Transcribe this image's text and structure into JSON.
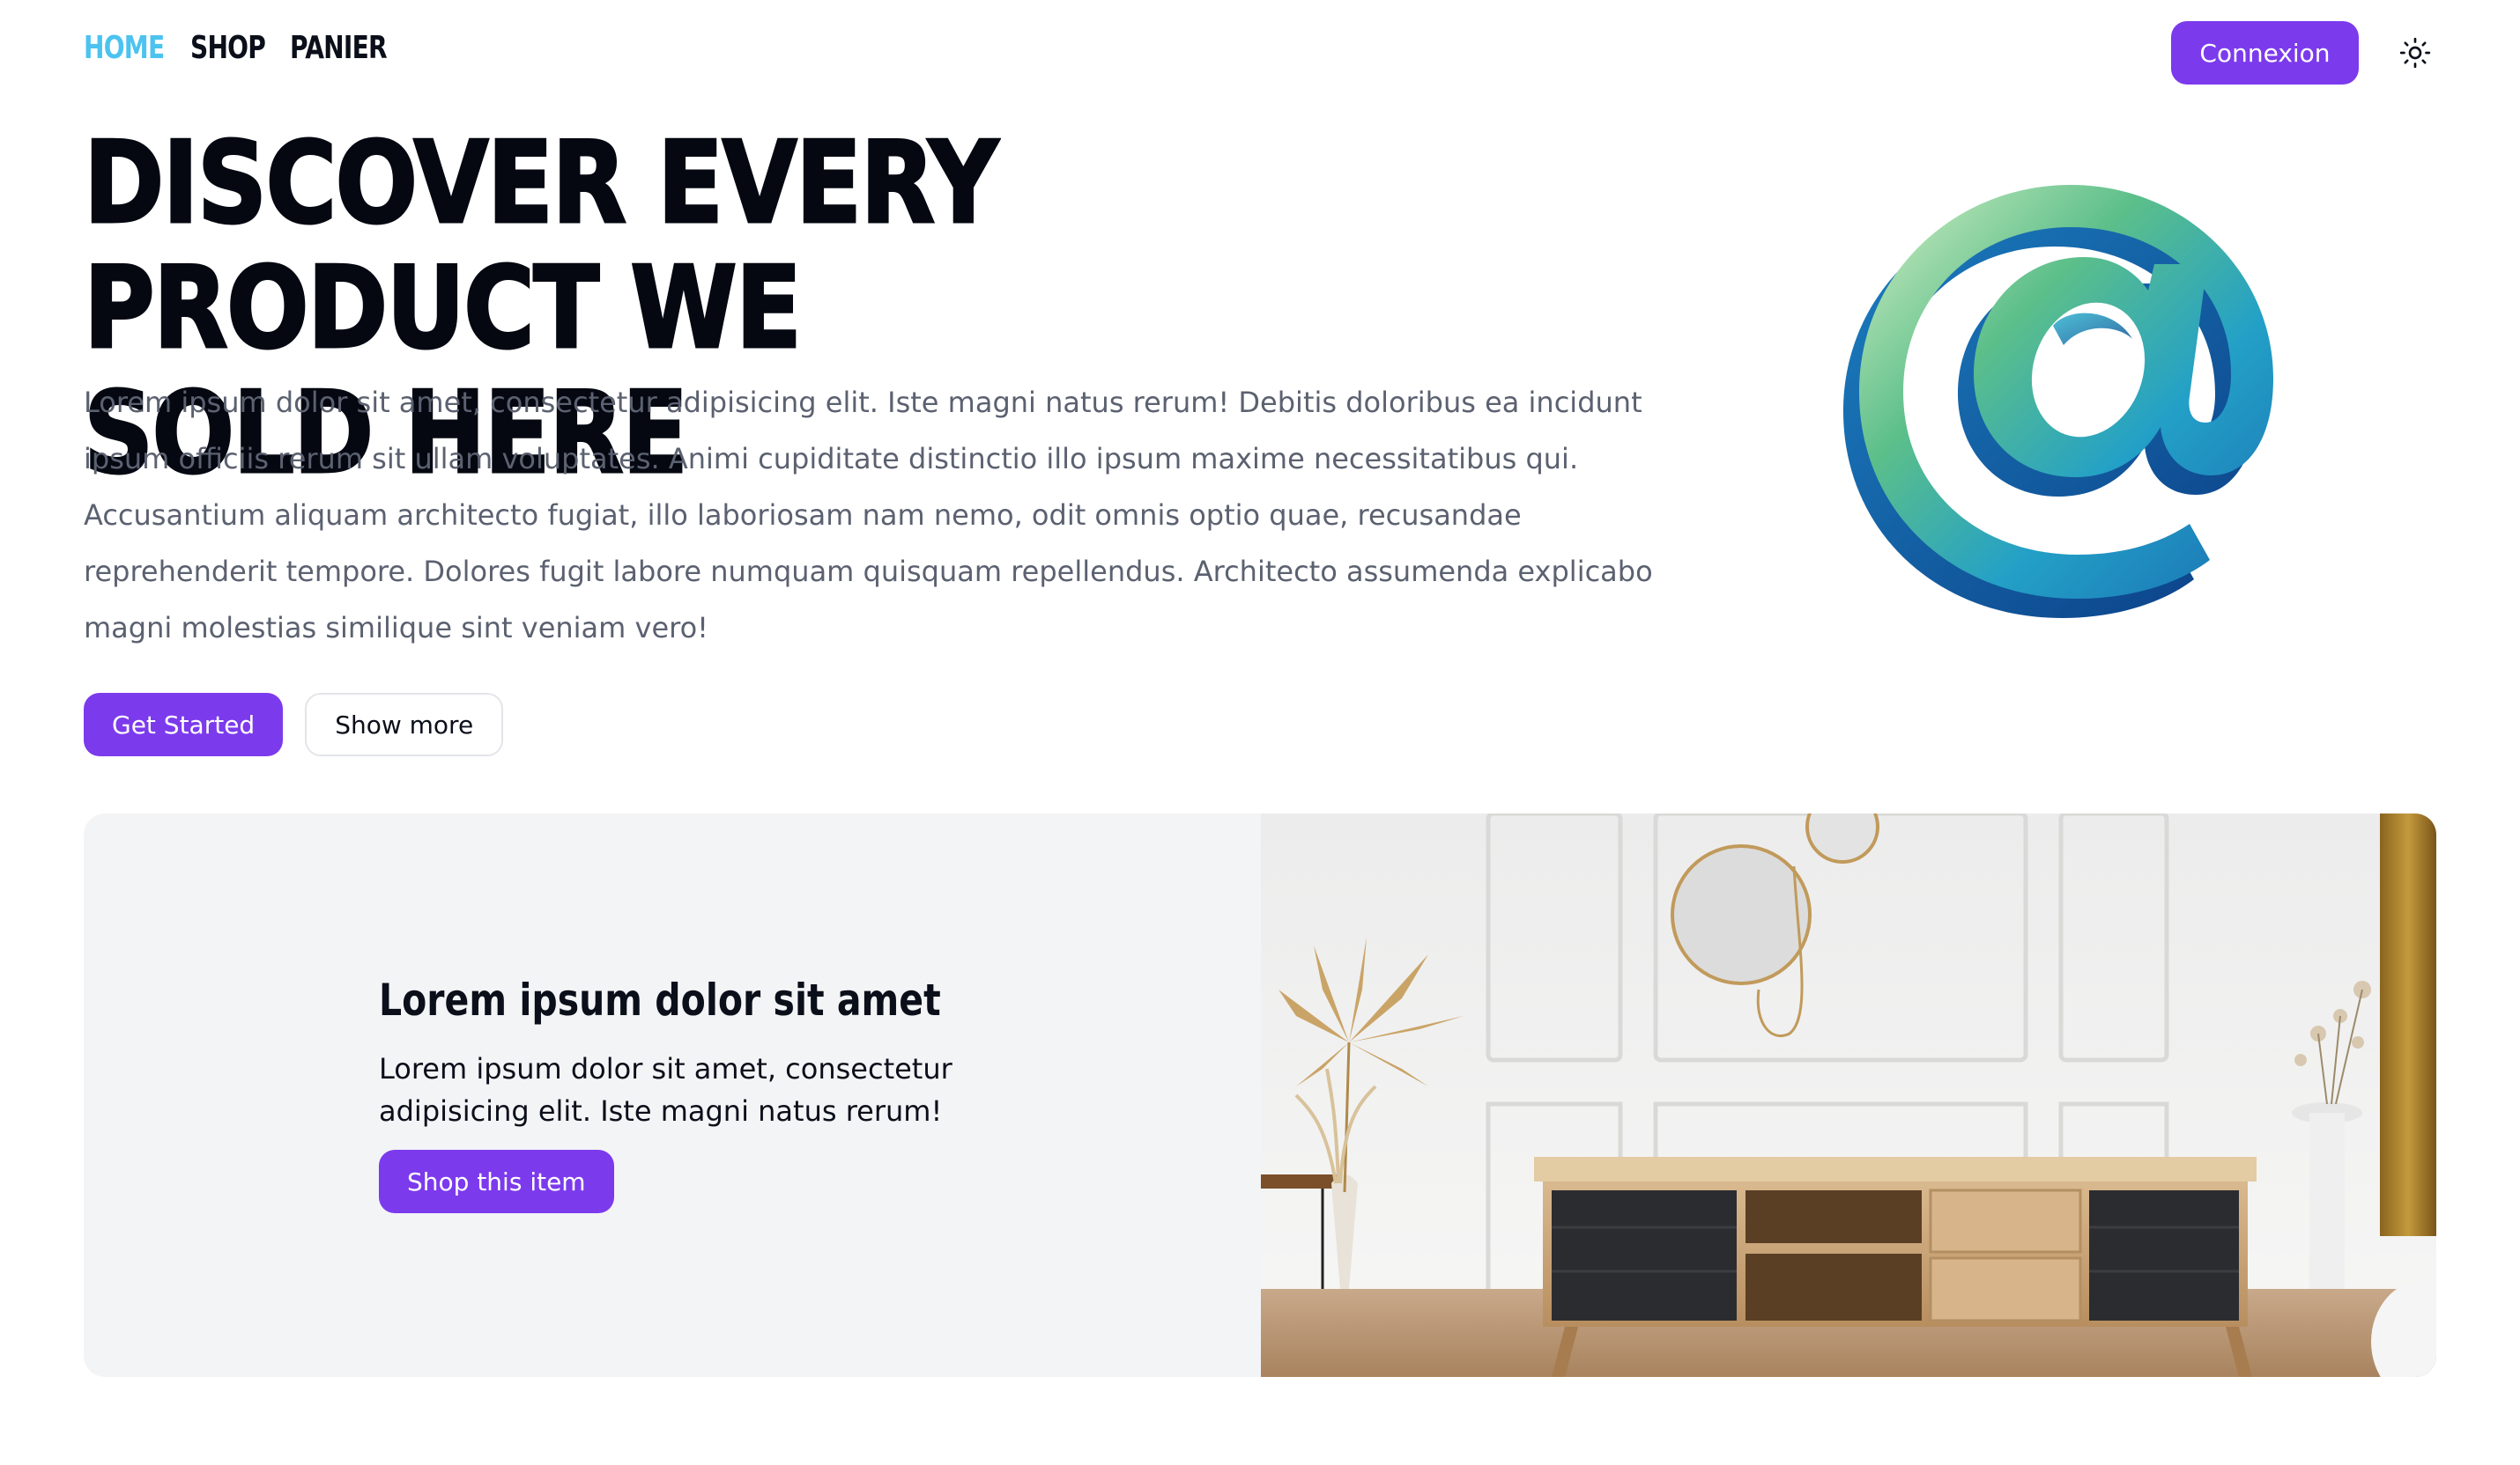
{
  "nav": {
    "links": [
      {
        "label": "HOME",
        "active": true
      },
      {
        "label": "SHOP",
        "active": false
      },
      {
        "label": "PANIER",
        "active": false
      }
    ],
    "login_label": "Connexion",
    "theme_icon": "sun-icon"
  },
  "hero": {
    "title_line1": "DISCOVER EVERY PRODUCT WE",
    "title_line2": "SOLD HERE",
    "text": "Lorem ipsum dolor sit amet, consectetur adipisicing elit. Iste magni natus rerum! Debitis doloribus ea incidunt ipsum officiis rerum sit ullam voluptates. Animi cupiditate distinctio illo ipsum maxime necessitatibus qui. Accusantium aliquam architecto fugiat, illo laboriosam nam nemo, odit omnis optio quae, recusandae reprehenderit tempore. Dolores fugit labore numquam quisquam repellendus. Architecto assumenda explicabo magni molestias similique sint veniam vero!",
    "primary_button": "Get Started",
    "secondary_button": "Show more",
    "art_icon": "at-sign-3d-icon"
  },
  "feature": {
    "title": "Lorem ipsum dolor sit amet",
    "text": "Lorem ipsum dolor sit amet, consectetur adipisicing elit. Iste magni natus rerum!",
    "button": "Shop this item",
    "image": "tv-console-living-room-photo"
  },
  "colors": {
    "accent": "#7c3aed",
    "nav_active": "#4cc3ef",
    "heading": "#050811",
    "body_text": "#5b6170",
    "card_bg": "#f3f4f6"
  }
}
